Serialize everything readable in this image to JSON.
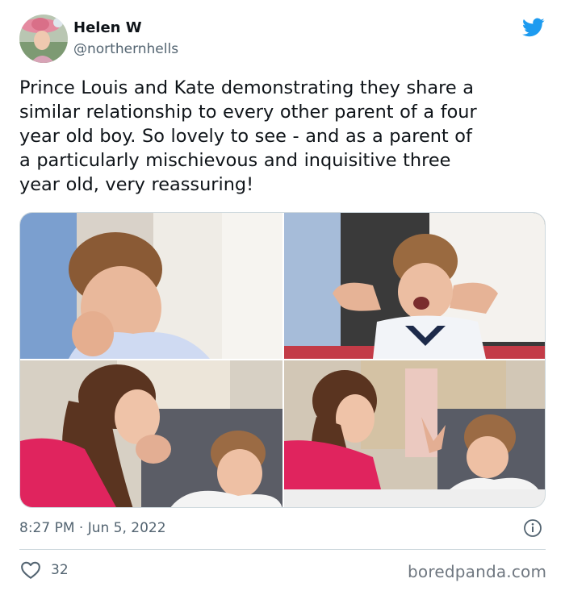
{
  "author": {
    "name": "Helen W",
    "handle": "@northernhells",
    "avatar_icon": "profile-photo-avatar"
  },
  "platform_icon": "twitter-bird-icon",
  "brand_color": "#1d9bf0",
  "tweet": {
    "lines": [
      "Prince Louis and Kate demonstrating they share a",
      "similar relationship to every other parent of a four",
      "year old boy. So lovely to see - and as a parent of",
      "a particularly mischievous and inquisitive three",
      "year old, very reassuring!"
    ]
  },
  "media": {
    "photo_count": 4
  },
  "meta": {
    "timestamp": "8:27 PM · Jun 5, 2022",
    "info_icon": "info-circle-icon"
  },
  "engagement": {
    "likes": "32",
    "like_icon": "heart-outline-icon"
  },
  "watermark": "boredpanda.com"
}
